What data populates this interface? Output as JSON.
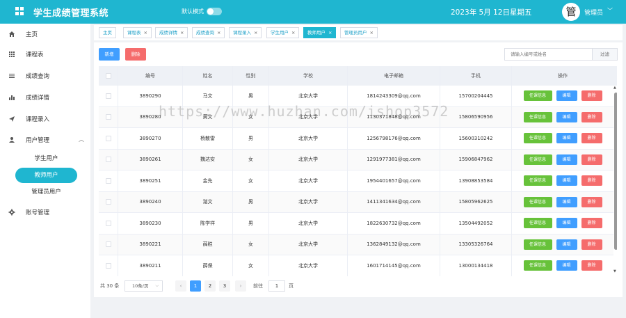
{
  "header": {
    "title": "学生成绩管理系统",
    "mode_label": "默认模式",
    "date": "2023年 5月 12日",
    "weekday": "星期五",
    "avatar_char": "管",
    "user_name": "管理员",
    "chevron": "﹀"
  },
  "sidebar": {
    "items": [
      {
        "label": "主页",
        "icon": "home-icon"
      },
      {
        "label": "课程表",
        "icon": "grid-icon"
      },
      {
        "label": "成绩查询",
        "icon": "list-icon"
      },
      {
        "label": "成绩详情",
        "icon": "bar-chart-icon"
      },
      {
        "label": "课程录入",
        "icon": "send-icon"
      },
      {
        "label": "用户管理",
        "icon": "user-icon",
        "arrow": "︿"
      },
      {
        "label": "账号管理",
        "icon": "gear-icon"
      }
    ],
    "sub_items": [
      "学生用户",
      "教师用户",
      "管理员用户"
    ]
  },
  "tabs": [
    {
      "label": "主页"
    },
    {
      "label": "课程表"
    },
    {
      "label": "成绩详情"
    },
    {
      "label": "成绩查询"
    },
    {
      "label": "课程录入"
    },
    {
      "label": "学生用户"
    },
    {
      "label": "教师用户"
    },
    {
      "label": "管理员用户"
    }
  ],
  "tab_close": "×",
  "toolbar": {
    "add_label": "新增",
    "delete_label": "删除",
    "search_placeholder": "请输入编号或姓名",
    "filter_label": "过滤"
  },
  "table": {
    "columns": [
      "编号",
      "姓名",
      "性别",
      "学校",
      "电子邮箱",
      "手机",
      "操作"
    ],
    "rows": [
      {
        "id": "3890290",
        "name": "马文",
        "gender": "男",
        "school": "北京大学",
        "email": "1814243309@qq.com",
        "phone": "15700204445"
      },
      {
        "id": "3890280",
        "name": "黄文",
        "gender": "女",
        "school": "北京大学",
        "email": "1130371848@qq.com",
        "phone": "15806590956"
      },
      {
        "id": "3890270",
        "name": "杨散雷",
        "gender": "男",
        "school": "北京大学",
        "email": "1256798176@qq.com",
        "phone": "15600310242"
      },
      {
        "id": "3890261",
        "name": "魏达安",
        "gender": "女",
        "school": "北京大学",
        "email": "1291977381@qq.com",
        "phone": "15906847962"
      },
      {
        "id": "3890251",
        "name": "金先",
        "gender": "女",
        "school": "北京大学",
        "email": "1954401657@qq.com",
        "phone": "13908853584"
      },
      {
        "id": "3890240",
        "name": "湛文",
        "gender": "男",
        "school": "北京大学",
        "email": "1411341634@qq.com",
        "phone": "15805962625"
      },
      {
        "id": "3890230",
        "name": "陈学祥",
        "gender": "男",
        "school": "北京大学",
        "email": "1822630732@qq.com",
        "phone": "13504492052"
      },
      {
        "id": "3890221",
        "name": "薛胜",
        "gender": "女",
        "school": "北京大学",
        "email": "1362849132@qq.com",
        "phone": "13305326764"
      },
      {
        "id": "3890211",
        "name": "薛保",
        "gender": "女",
        "school": "北京大学",
        "email": "1601714145@qq.com",
        "phone": "13000134418"
      }
    ],
    "op_info": "任课信息",
    "op_edit": "编辑",
    "op_delete": "删除"
  },
  "pagination": {
    "total": "共 30 条",
    "page_size": "10条/页",
    "pages": [
      "1",
      "2",
      "3"
    ],
    "prev": "‹",
    "next": "›",
    "goto_label": "前往",
    "goto_value": "1",
    "page_unit": "页"
  },
  "watermark": "https://www.huzhan.com/ishop3572",
  "colors": {
    "brand": "#1fb6d0",
    "primary": "#409eff",
    "success": "#67c23a",
    "danger": "#f56c6c"
  }
}
